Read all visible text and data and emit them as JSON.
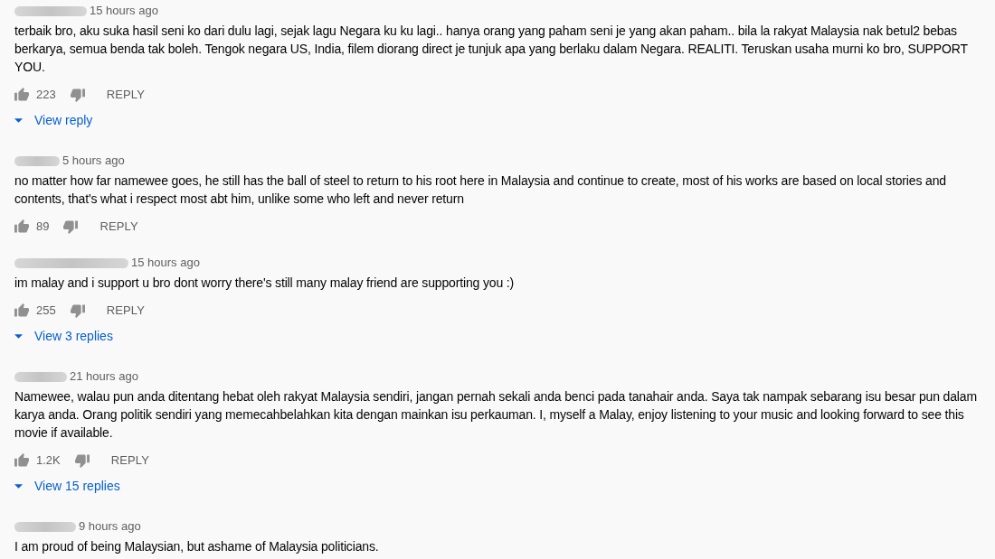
{
  "comments": [
    {
      "time": "15 hours ago",
      "text": "terbaik bro, aku suka hasil seni ko dari dulu lagi, sejak lagu Negara ku ku lagi.. hanya orang yang paham seni je yang akan paham.. bila la rakyat Malaysia nak betul2 bebas berkarya, semua benda tak boleh. Tengok negara US, India, filem diorang direct je tunjuk apa yang berlaku dalam Negara. REALITI. Teruskan usaha murni ko bro, SUPPORT YOU.",
      "likes": "223",
      "reply_button": "REPLY",
      "replies_link": "View reply"
    },
    {
      "time": "5 hours ago",
      "text": "no matter how far namewee goes, he still has the ball of steel to return to his root here in Malaysia and continue to create, most of his works are based on local stories and contents, that's what i respect most abt him, unlike some who left and never return",
      "likes": "89",
      "reply_button": "REPLY"
    },
    {
      "time": "15 hours ago",
      "text": "im malay and i support u bro dont worry there's still many malay friend are supporting you :)",
      "likes": "255",
      "reply_button": "REPLY",
      "replies_link": "View 3 replies"
    },
    {
      "time": "21 hours ago",
      "text": "Namewee, walau pun anda ditentang hebat oleh rakyat Malaysia sendiri, jangan pernah sekali anda benci pada tanahair anda. Saya tak nampak sebarang isu besar pun dalam karya anda. Orang politik sendiri yang memecahbelahkan kita dengan mainkan isu perkauman. I, myself a Malay, enjoy listening to your music and looking forward to see this movie if available.",
      "likes": "1.2K",
      "reply_button": "REPLY",
      "replies_link": "View 15 replies"
    },
    {
      "time": "9 hours ago",
      "text": "I am proud of being Malaysian, but ashame of Malaysia politicians."
    }
  ]
}
